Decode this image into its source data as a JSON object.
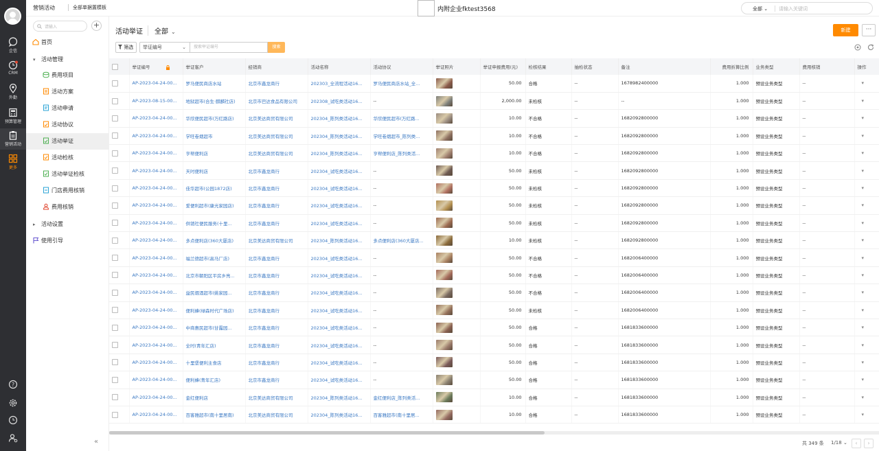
{
  "rail": {
    "items": [
      {
        "label": "企信",
        "icon": "chat-bubble-icon"
      },
      {
        "label": "CRM",
        "icon": "crm-clock-icon"
      },
      {
        "label": "外勤",
        "icon": "location-pin-icon"
      },
      {
        "label": "预算管理",
        "icon": "calculator-icon"
      },
      {
        "label": "营销活动",
        "icon": "clipboard-icon"
      },
      {
        "label": "更多",
        "icon": "grid-apps-icon"
      }
    ],
    "bottom_icons": [
      "help-icon",
      "settings-icon",
      "history-icon",
      "user-settings-icon"
    ]
  },
  "topbar": {
    "crumb": "营销活动",
    "tab": "全部单据置模板",
    "company": "内附企业fktest3568",
    "search_scope": "全部",
    "search_placeholder": "请输入关键词"
  },
  "sidebar": {
    "search_placeholder": "请输入",
    "home": "首页",
    "group_activity": "活动管理",
    "items": [
      "费用项目",
      "活动方案",
      "活动申请",
      "活动协议",
      "活动举证",
      "活动检核",
      "活动举证检核",
      "门店费用核销",
      "费用核销"
    ],
    "group_settings": "活动设置",
    "guide": "使用引导"
  },
  "page": {
    "title": "活动举证",
    "view": "全部",
    "new_button": "新建",
    "more_button": "···",
    "filter_button": "筛选",
    "field_select": "举证编号",
    "search_placeholder": "搜索举证编号",
    "search_button": "搜索"
  },
  "table": {
    "columns": [
      "举证编号",
      "举证客户",
      "经销商",
      "活动名称",
      "活动协议",
      "举证照片",
      "举证申报费用(元)",
      "检核结果",
      "抽检状态",
      "备注",
      "费用折算比例",
      "业务类型",
      "费用核销",
      "操作"
    ],
    "rows": [
      [
        "AP-2023-04-24-00...",
        "罗马便民商店水站",
        "北京市鑫龙商行",
        "202303_全流程活动16...",
        "罗马便民商店水站_全...",
        "50.00",
        "合格",
        "--",
        "1678982400000",
        "1.000",
        "预设业务类型",
        "--"
      ],
      [
        "AP-2023-08-15-00...",
        "地狱超市(合生·麒麟社店)",
        "北京市巴达食品有限公司",
        "202308_试吃类活动16...",
        "--",
        "2,000.00",
        "未检核",
        "--",
        "--",
        "1.000",
        "预设业务类型",
        "--"
      ],
      [
        "AP-2023-04-24-00...",
        "华欣便民超市(万红路店)",
        "北京美达商贸有限公司",
        "202304_陈列类活动16...",
        "华欣便民超市(万红路...",
        "10.00",
        "不合格",
        "--",
        "1682092800000",
        "1.000",
        "预设业务类型",
        "--"
      ],
      [
        "AP-2023-04-24-00...",
        "学旺卷烟超市",
        "北京美达商贸有限公司",
        "202304_陈列类活动16...",
        "学旺卷烟超市_陈列类...",
        "10.00",
        "不合格",
        "--",
        "1682092800000",
        "1.000",
        "预设业务类型",
        "--"
      ],
      [
        "AP-2023-04-24-00...",
        "亨帮便利店",
        "北京美达商贸有限公司",
        "202304_陈列类活动16...",
        "亨帮便利店_陈列类活...",
        "10.00",
        "不合格",
        "--",
        "1682092800000",
        "1.000",
        "预设业务类型",
        "--"
      ],
      [
        "AP-2023-04-24-00...",
        "天时便利店",
        "北京市鑫龙商行",
        "202304_试吃类活动16...",
        "--",
        "50.00",
        "未检核",
        "--",
        "1682092800000",
        "1.000",
        "预设业务类型",
        "--"
      ],
      [
        "AP-2023-04-24-00...",
        "佳华超市(公园1872店)",
        "北京市鑫龙商行",
        "202304_试吃类活动16...",
        "--",
        "50.00",
        "未检核",
        "--",
        "1682092800000",
        "1.000",
        "预设业务类型",
        "--"
      ],
      [
        "AP-2023-04-24-00...",
        "爱便利超市(康光家园店)",
        "北京市鑫龙商行",
        "202304_试吃类活动16...",
        "--",
        "50.00",
        "未检核",
        "--",
        "1682092800000",
        "1.000",
        "预设业务类型",
        "--"
      ],
      [
        "AP-2023-04-24-00...",
        "供销社便民服务(十里...",
        "北京市鑫龙商行",
        "202304_试吃类活动16...",
        "--",
        "50.00",
        "未检核",
        "--",
        "1682092800000",
        "1.000",
        "预设业务类型",
        "--"
      ],
      [
        "AP-2023-04-24-00...",
        "多点便利店(360大厦店)",
        "北京美达商贸有限公司",
        "202304_陈列类活动16...",
        "多点便利店(360大厦店...",
        "10.00",
        "未检核",
        "--",
        "1682092800000",
        "1.000",
        "预设业务类型",
        "--"
      ],
      [
        "AP-2023-04-24-00...",
        "福兰德超市(高马厂店)",
        "北京市鑫龙商行",
        "202304_试吃类活动16...",
        "--",
        "50.00",
        "不合格",
        "--",
        "1682006400000",
        "1.000",
        "预设业务类型",
        "--"
      ],
      [
        "AP-2023-04-24-00...",
        "北京市朝阳区平房乡亮...",
        "北京市鑫龙商行",
        "202304_试吃类活动16...",
        "--",
        "50.00",
        "不合格",
        "--",
        "1682006400000",
        "1.000",
        "预设业务类型",
        "--"
      ],
      [
        "AP-2023-04-24-00...",
        "益民烟酒超市(姚家园...",
        "北京市鑫龙商行",
        "202304_试吃类活动16...",
        "--",
        "50.00",
        "不合格",
        "--",
        "1682006400000",
        "1.000",
        "预设业务类型",
        "--"
      ],
      [
        "AP-2023-04-24-00...",
        "便利蜂(绿森时代广场店)",
        "北京市鑫龙商行",
        "202304_试吃类活动16...",
        "--",
        "50.00",
        "未检核",
        "--",
        "1682006400000",
        "1.000",
        "预设业务类型",
        "--"
      ],
      [
        "AP-2023-04-24-00...",
        "中商惠民超市(甘露园...",
        "北京市鑫龙商行",
        "202304_试吃类活动16...",
        "--",
        "50.00",
        "合格",
        "--",
        "1681833600000",
        "1.000",
        "预设业务类型",
        "--"
      ],
      [
        "AP-2023-04-24-00...",
        "全时(青年汇店)",
        "北京市鑫龙商行",
        "202304_试吃类活动16...",
        "--",
        "50.00",
        "合格",
        "--",
        "1681833600000",
        "1.000",
        "预设业务类型",
        "--"
      ],
      [
        "AP-2023-04-24-00...",
        "十里堡便利主食店",
        "北京市鑫龙商行",
        "202304_试吃类活动16...",
        "--",
        "50.00",
        "合格",
        "--",
        "1681833600000",
        "1.000",
        "预设业务类型",
        "--"
      ],
      [
        "AP-2023-04-24-00...",
        "便利蜂(青年汇店)",
        "北京市鑫龙商行",
        "202304_试吃类活动16...",
        "--",
        "50.00",
        "合格",
        "--",
        "1681833600000",
        "1.000",
        "预设业务类型",
        "--"
      ],
      [
        "AP-2023-04-24-00...",
        "金红便利店",
        "北京美达商贸有限公司",
        "202304_陈列类活动16...",
        "金红便利店_陈列类活...",
        "10.00",
        "合格",
        "--",
        "1681833600000",
        "1.000",
        "预设业务类型",
        "--"
      ],
      [
        "AP-2023-04-24-00...",
        "百客雅超市(南十里居南)",
        "北京美达商贸有限公司",
        "202304_陈列类活动16...",
        "百客雅超市(南十里居...",
        "10.00",
        "合格",
        "--",
        "1681833600000",
        "1.000",
        "预设业务类型",
        "--"
      ]
    ],
    "photo_colors": [
      "#8a5a4a",
      "#7d7f7a",
      "#9a8c80",
      "#8e7060",
      "#a08070",
      "#6e5a52",
      "#b07060",
      "#b49050",
      "#9c6a50",
      "#8a6a3a",
      "#a88060",
      "#a46a5a",
      "#7a6a60",
      "#94705a",
      "#8a6050",
      "#9a7a6a",
      "#7a5a5a",
      "#8a8070",
      "#6a7a5a",
      "#946a60"
    ]
  },
  "footer": {
    "total": "共 349 条",
    "page": "1/18"
  },
  "colors": {
    "accent": "#ff8a00",
    "link": "#3a78c3",
    "rail": "#2e2f33"
  }
}
